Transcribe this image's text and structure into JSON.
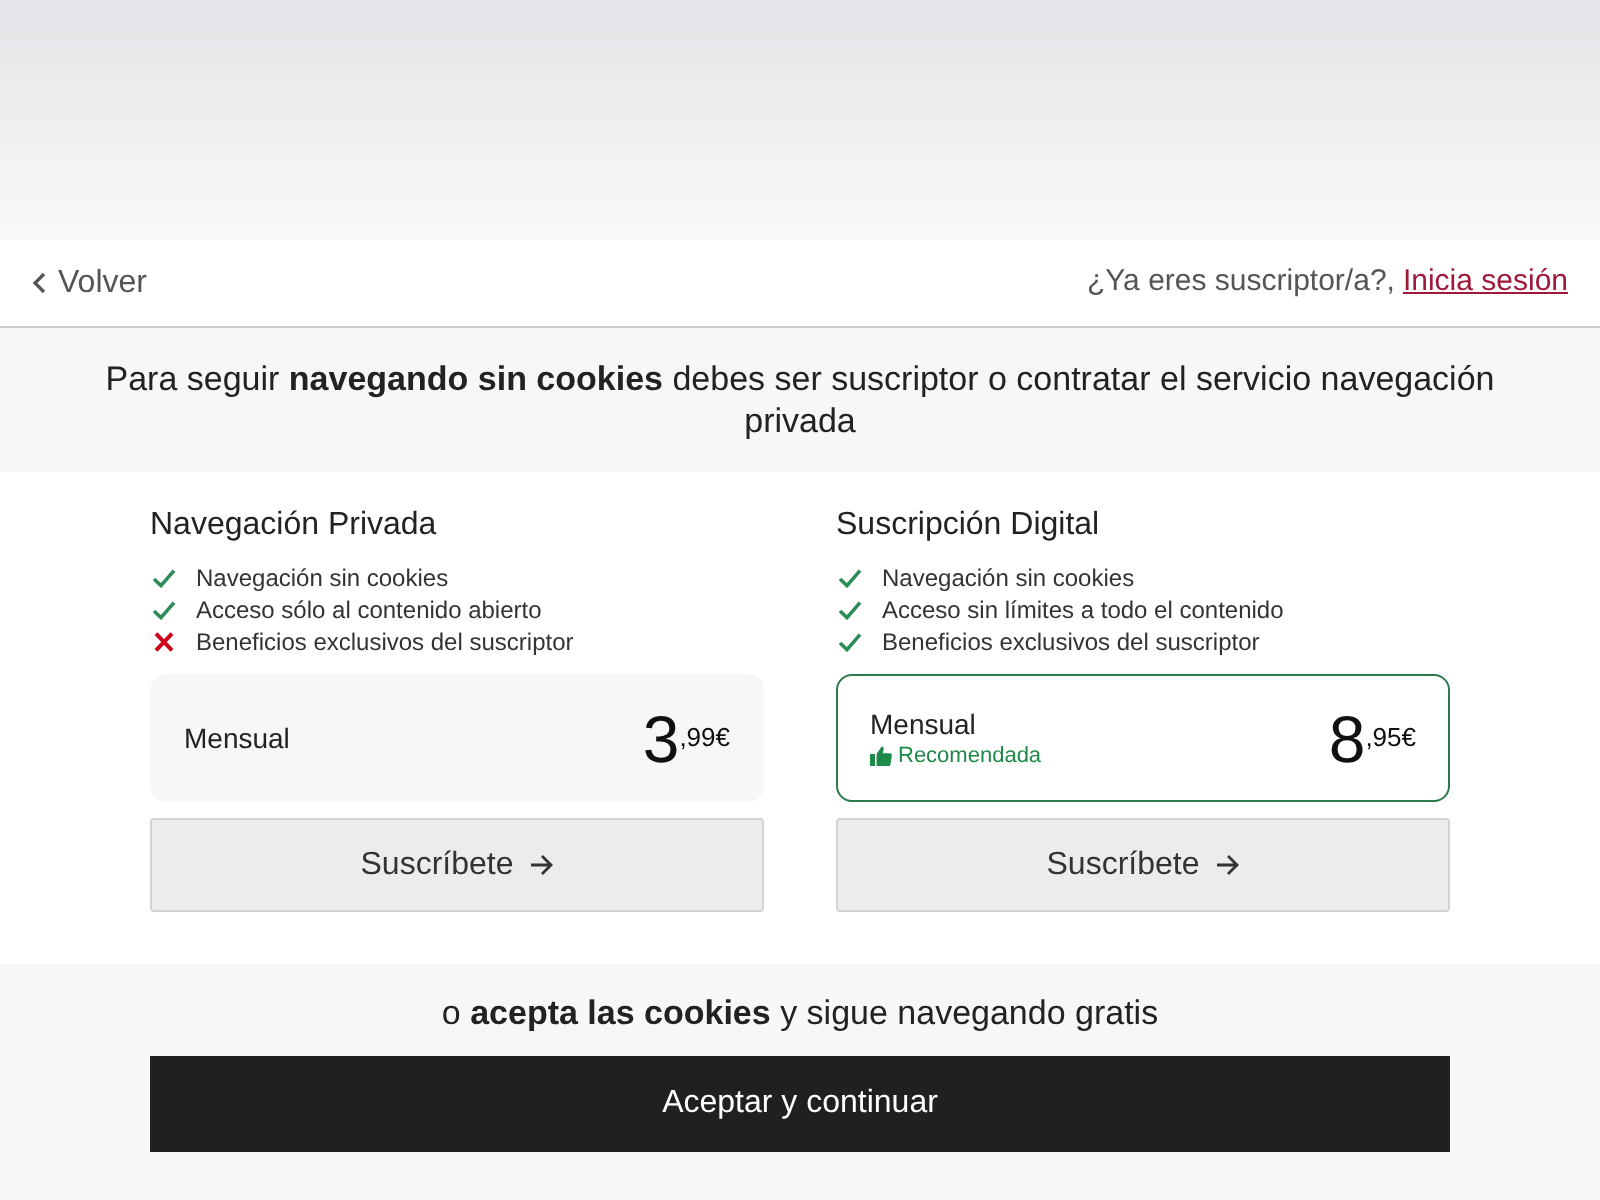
{
  "header": {
    "back_label": "Volver",
    "login_prompt": "¿Ya eres suscriptor/a?,",
    "login_link": "Inicia sesión"
  },
  "headline": "Para seguir **navegando sin cookies** debes ser suscriptor o contratar el servicio navegación privada",
  "plans": [
    {
      "title": "Navegación Privada",
      "features": [
        {
          "text": "Navegación sin cookies",
          "included": true
        },
        {
          "text": "Acceso sólo al contenido abierto",
          "included": true
        },
        {
          "text": "Beneficios exclusivos del suscriptor",
          "included": false
        }
      ],
      "period": "Mensual",
      "recommended": false,
      "price": "3$^{,99€}$",
      "button": "Suscríbete"
    },
    {
      "title": "Suscripción Digital",
      "features": [
        {
          "text": "Navegación sin cookies",
          "included": true
        },
        {
          "text": "Acceso sin límites a todo el contenido",
          "included": true
        },
        {
          "text": "Beneficios exclusivos del suscriptor",
          "included": true
        }
      ],
      "period": "Mensual",
      "recommended": true,
      "badge": "Recomendada",
      "price": "8$^{,95€}$",
      "button": "Suscríbete"
    }
  ],
  "footer": {
    "text": "o **acepta las cookies** y sigue navegando gratis",
    "button": "Aceptar y continuar"
  }
}
